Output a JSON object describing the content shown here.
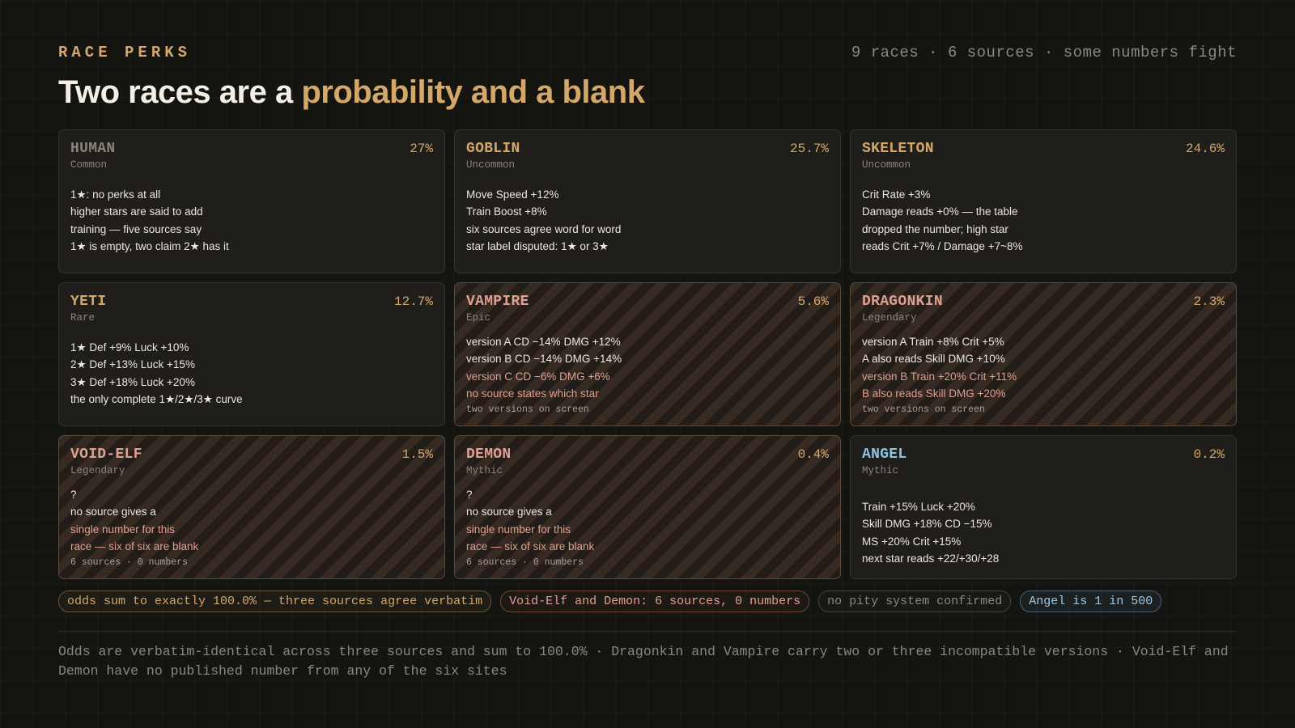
{
  "header": {
    "kicker": "RACE PERKS",
    "meta": "9 races · 6 sources · some numbers fight",
    "headline_plain": "Two races are a ",
    "headline_accent": "probability and a blank"
  },
  "colors": {
    "gold": "#d4a86a",
    "salmon": "#dea090",
    "blue": "#8ec3e8",
    "grey_name": "#8a857a"
  },
  "cards": [
    {
      "name": "HUMAN",
      "rarity": "Common",
      "pct": "27%",
      "lines": [
        {
          "text": "1★: no perks at all"
        },
        {
          "text": "higher stars are said to add"
        },
        {
          "text": "training — five sources say"
        },
        {
          "text": "1★ is empty, two claim 2★ has it"
        }
      ]
    },
    {
      "name": "GOBLIN",
      "rarity": "Uncommon",
      "pct": "25.7%",
      "lines": [
        {
          "text": "Move Speed +12%"
        },
        {
          "text": "Train Boost +8%"
        },
        {
          "text": "six sources agree word for word"
        },
        {
          "text": "star label disputed: 1★ or 3★"
        }
      ]
    },
    {
      "name": "SKELETON",
      "rarity": "Uncommon",
      "pct": "24.6%",
      "lines": [
        {
          "text": "Crit Rate +3%"
        },
        {
          "text": "Damage reads +0% — the table"
        },
        {
          "text": "dropped the number; high star"
        },
        {
          "text": "reads Crit +7% / Damage +7~8%"
        }
      ]
    },
    {
      "name": "YETI",
      "rarity": "Rare",
      "pct": "12.7%",
      "lines": [
        {
          "text": "1★ Def +9% Luck +10%"
        },
        {
          "text": "2★ Def +13% Luck +15%"
        },
        {
          "text": "3★ Def +18% Luck +20%"
        },
        {
          "text": "the only complete 1★/2★/3★ curve"
        }
      ]
    },
    {
      "name": "VAMPIRE",
      "rarity": "Epic",
      "pct": "5.6%",
      "lines": [
        {
          "text": "version A CD −14% DMG +12%"
        },
        {
          "text": "version B CD −14% DMG +14%"
        },
        {
          "text": "version C CD −6% DMG +6%"
        },
        {
          "text": "no source states which star"
        },
        {
          "text": "two versions on screen"
        }
      ]
    },
    {
      "name": "DRAGONKIN",
      "rarity": "Legendary",
      "pct": "2.3%",
      "lines": [
        {
          "text": "version A Train +8% Crit +5%"
        },
        {
          "text": "A also reads Skill DMG +10%"
        },
        {
          "text": "version B Train +20% Crit +11%"
        },
        {
          "text": "B also reads Skill DMG +20%"
        },
        {
          "text": "two versions on screen"
        }
      ]
    },
    {
      "name": "VOID-ELF",
      "rarity": "Legendary",
      "pct": "1.5%",
      "lines": [
        {
          "text": "?"
        },
        {
          "text": "no source gives a"
        },
        {
          "text": "single number for this"
        },
        {
          "text": "race — six of six are blank"
        },
        {
          "text": "6 sources · 0 numbers"
        }
      ]
    },
    {
      "name": "DEMON",
      "rarity": "Mythic",
      "pct": "0.4%",
      "lines": [
        {
          "text": "?"
        },
        {
          "text": "no source gives a"
        },
        {
          "text": "single number for this"
        },
        {
          "text": "race — six of six are blank"
        },
        {
          "text": "6 sources · 0 numbers"
        }
      ]
    },
    {
      "name": "ANGEL",
      "rarity": "Mythic",
      "pct": "0.2%",
      "lines": [
        {
          "text": "Train +15% Luck +20%"
        },
        {
          "text": "Skill DMG +18% CD −15%"
        },
        {
          "text": "MS +20% Crit +15%"
        },
        {
          "text": "next star reads +22/+30/+28"
        }
      ]
    }
  ],
  "pills": [
    {
      "text": "odds sum to exactly 100.0% — three sources agree verbatim"
    },
    {
      "text": "Void-Elf and Demon: 6 sources, 0 numbers"
    },
    {
      "text": "no pity system confirmed"
    },
    {
      "text": "Angel is 1 in 500"
    }
  ],
  "footnote": "Odds are verbatim-identical across three sources and sum to 100.0% · Dragonkin and Vampire carry two or three incompatible versions · Void-Elf and Demon have no published number from any of the six sites"
}
